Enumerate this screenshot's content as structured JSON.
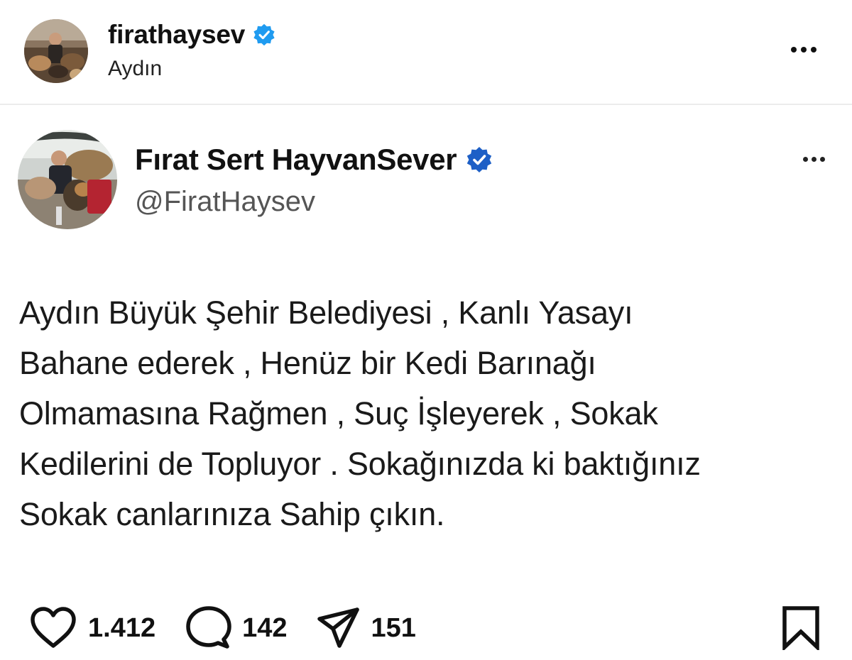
{
  "post": {
    "username": "firathaysev",
    "location": "Aydın",
    "verified_icon": "verified-badge-icon",
    "more_icon": "more-horizontal-icon"
  },
  "tweet": {
    "display_name": "Fırat Sert HayvanSever",
    "handle": "@FiratHaysev",
    "verified_icon": "verified-badge-icon",
    "more_icon": "more-horizontal-icon",
    "text": "Aydın Büyük Şehir Belediyesi , Kanlı Yasayı\nBahane ederek , Henüz bir Kedi Barınağı\nOlmamasına Rağmen , Suç İşleyerek , Sokak\nKedilerini de Topluyor . Sokağınızda ki baktığınız\nSokak canlarınıza Sahip çıkın."
  },
  "actions": {
    "likes": "1.412",
    "comments": "142",
    "shares": "151",
    "like_icon": "heart-icon",
    "comment_icon": "comment-bubble-icon",
    "share_icon": "send-paper-plane-icon",
    "bookmark_icon": "bookmark-icon"
  },
  "colors": {
    "verified_blue_ig": "#1f9bf0",
    "verified_blue_tw": "#1d5fc6",
    "text": "#111111",
    "secondary_text": "#555555",
    "divider": "#ececec"
  }
}
